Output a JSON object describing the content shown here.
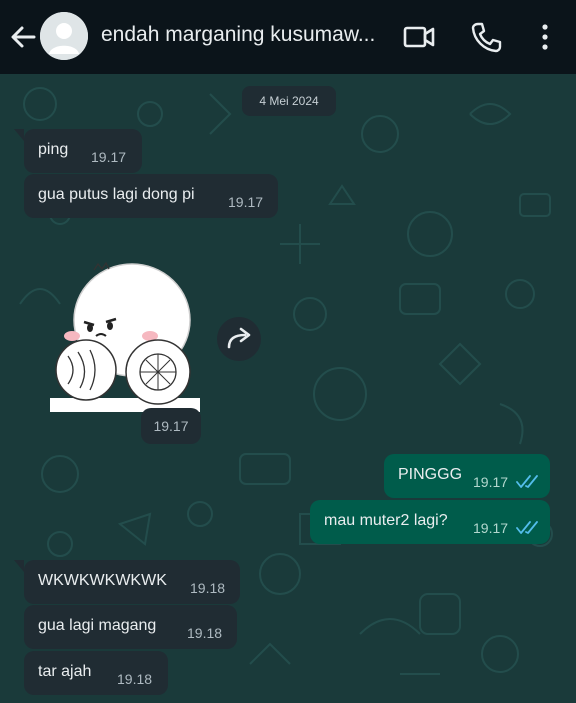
{
  "header": {
    "contact_name": "endah marganing kusumaw..."
  },
  "colors": {
    "header_bg": "#0b141a",
    "incoming_bubble": "#202c33",
    "outgoing_bubble": "#005c4b",
    "read_tick": "#53bdeb",
    "chat_bg": "#1a3a3a"
  },
  "icons": {
    "back": "arrow-left-icon",
    "avatar": "default-avatar-icon",
    "video": "video-camera-icon",
    "call": "phone-icon",
    "menu": "more-vertical-icon",
    "forward": "forward-icon",
    "read": "double-check-icon"
  },
  "chat": {
    "date_label": "4 Mei 2024",
    "messages": [
      {
        "text": "ping",
        "time": "19.17"
      },
      {
        "text": "gua putus lagi dong pi",
        "time": "19.17"
      },
      {
        "sticker_time": "19.17"
      },
      {
        "text": "PINGGG",
        "time": "19.17"
      },
      {
        "text": "mau muter2 lagi?",
        "time": "19.17"
      },
      {
        "text": "WKWKWKWKWK",
        "time": "19.18"
      },
      {
        "text": "gua lagi magang",
        "time": "19.18"
      },
      {
        "text": "tar ajah",
        "time": "19.18"
      }
    ]
  }
}
